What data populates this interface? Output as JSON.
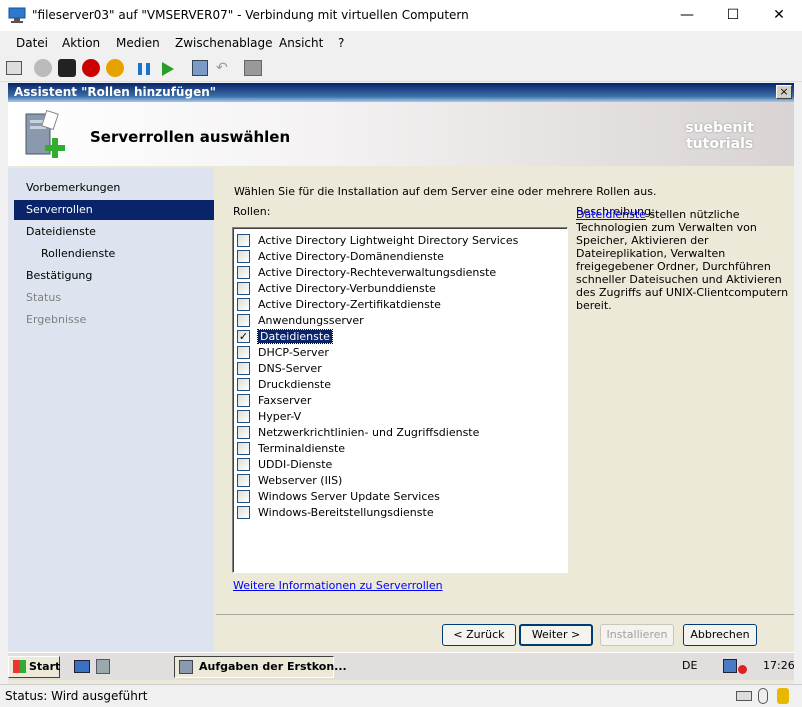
{
  "outer": {
    "title": "\"fileserver03\" auf \"VMSERVER07\" - Verbindung mit virtuellen Computern",
    "minimize": "—",
    "maximize": "☐",
    "close": "✕"
  },
  "menu": [
    "Datei",
    "Aktion",
    "Medien",
    "Zwischenablage",
    "Ansicht",
    "?"
  ],
  "wizard": {
    "title": "Assistent \"Rollen hinzufügen\"",
    "close": "×",
    "header": "Serverrollen auswählen",
    "brand_line1": "suebenit",
    "brand_line2": "tutorials",
    "nav": [
      "Vorbemerkungen",
      "Serverrollen",
      "Dateidienste",
      "Rollendienste",
      "Bestätigung",
      "Status",
      "Ergebnisse"
    ],
    "intro": "Wählen Sie für die Installation auf dem Server eine oder mehrere Rollen aus.",
    "roles_label": "Rollen:",
    "roles": [
      {
        "name": "Active Directory Lightweight Directory Services",
        "checked": ""
      },
      {
        "name": "Active Directory-Domänendienste",
        "checked": ""
      },
      {
        "name": "Active Directory-Rechteverwaltungsdienste",
        "checked": ""
      },
      {
        "name": "Active Directory-Verbunddienste",
        "checked": ""
      },
      {
        "name": "Active Directory-Zertifikatdienste",
        "checked": ""
      },
      {
        "name": "Anwendungsserver",
        "checked": ""
      },
      {
        "name": "Dateidienste",
        "checked": "✓"
      },
      {
        "name": "DHCP-Server",
        "checked": ""
      },
      {
        "name": "DNS-Server",
        "checked": ""
      },
      {
        "name": "Druckdienste",
        "checked": ""
      },
      {
        "name": "Faxserver",
        "checked": ""
      },
      {
        "name": "Hyper-V",
        "checked": ""
      },
      {
        "name": "Netzwerkrichtlinien- und Zugriffsdienste",
        "checked": ""
      },
      {
        "name": "Terminaldienste",
        "checked": ""
      },
      {
        "name": "UDDI-Dienste",
        "checked": ""
      },
      {
        "name": "Webserver (IIS)",
        "checked": ""
      },
      {
        "name": "Windows Server Update Services",
        "checked": ""
      },
      {
        "name": "Windows-Bereitstellungsdienste",
        "checked": ""
      }
    ],
    "desc_label": "Beschreibung:",
    "desc_link": "Dateidienste",
    "desc_text": " stellen nützliche Technologien zum Verwalten von Speicher, Aktivieren der Dateireplikation, Verwalten freigegebener Ordner, Durchführen schneller Dateisuchen und Aktivieren des Zugriffs auf UNIX-Clientcomputern bereit.",
    "more_link": "Weitere Informationen zu Serverrollen",
    "buttons": {
      "back": "< Zurück",
      "next": "Weiter >",
      "install": "Installieren",
      "cancel": "Abbrechen"
    }
  },
  "taskbar": {
    "start": "Start",
    "task": "Aufgaben der Erstkon...",
    "lang": "DE",
    "clock": "17:26"
  },
  "status": "Status: Wird ausgeführt"
}
